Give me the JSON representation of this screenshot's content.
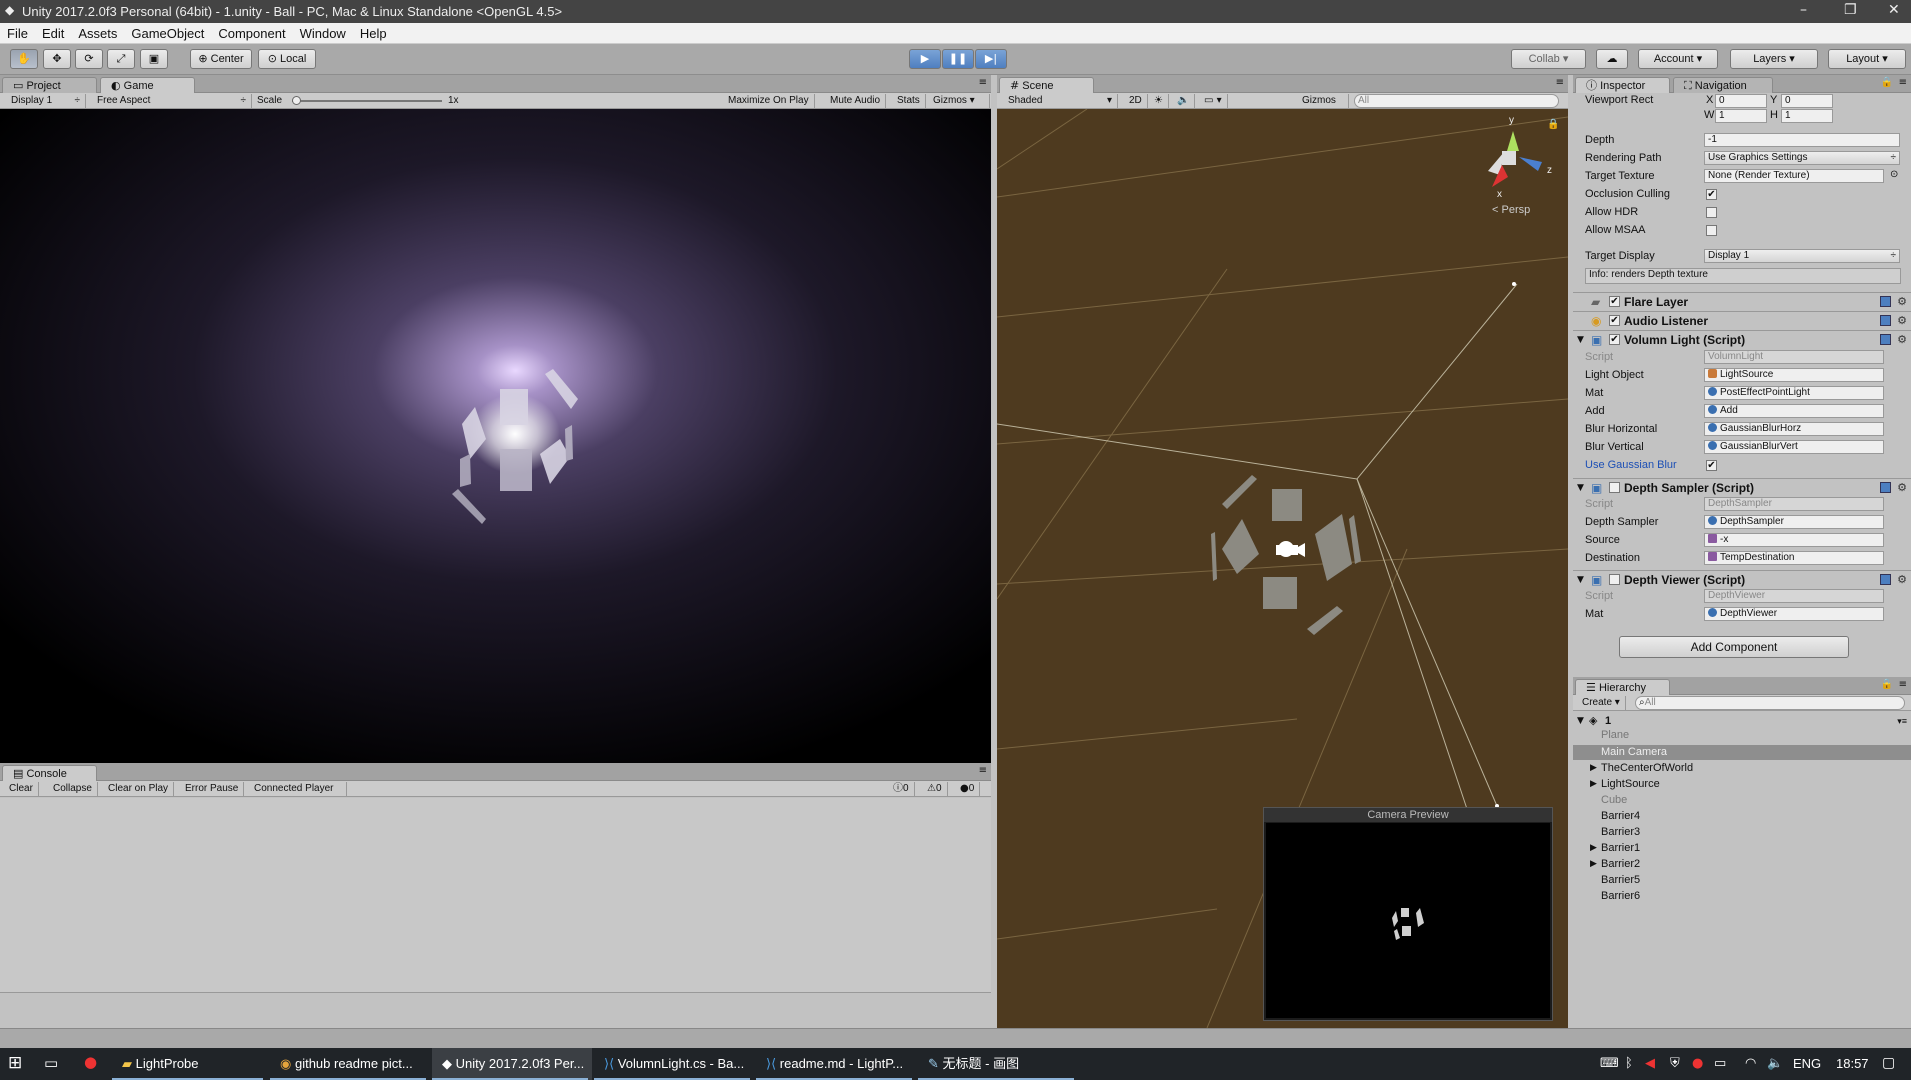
{
  "window": {
    "title": "Unity 2017.2.0f3 Personal (64bit) - 1.unity - Ball - PC, Mac & Linux Standalone <OpenGL 4.5>"
  },
  "menu": [
    "File",
    "Edit",
    "Assets",
    "GameObject",
    "Component",
    "Window",
    "Help"
  ],
  "toolbar": {
    "pivot": "Center",
    "space": "Local",
    "collab": "Collab",
    "account": "Account",
    "layers": "Layers",
    "layout": "Layout"
  },
  "left_tabs": {
    "project": "Project",
    "game": "Game"
  },
  "game_bar": {
    "display": "Display 1",
    "aspect": "Free Aspect",
    "scale_label": "Scale",
    "scale_value": "1x",
    "maximize": "Maximize On Play",
    "mute": "Mute Audio",
    "stats": "Stats",
    "gizmos": "Gizmos"
  },
  "scene_tab": "Scene",
  "scene_bar": {
    "shading": "Shaded",
    "mode2d": "2D",
    "gizmos": "Gizmos",
    "search_placeholder": "All"
  },
  "scene_gizmo": {
    "label": "Persp",
    "y": "y",
    "z": "z",
    "x": "x"
  },
  "camera_preview": {
    "title": "Camera Preview"
  },
  "inspector": {
    "tab": "Inspector",
    "nav_tab": "Navigation",
    "viewport_rect": {
      "label": "Viewport Rect",
      "x_label": "X",
      "x": "0",
      "y_label": "Y",
      "y": "0",
      "w_label": "W",
      "w": "1",
      "h_label": "H",
      "h": "1"
    },
    "depth": {
      "label": "Depth",
      "value": "-1"
    },
    "rendering_path": {
      "label": "Rendering Path",
      "value": "Use Graphics Settings"
    },
    "target_texture": {
      "label": "Target Texture",
      "value": "None (Render Texture)"
    },
    "occlusion": {
      "label": "Occlusion Culling",
      "checked": "✔"
    },
    "allow_hdr": {
      "label": "Allow HDR"
    },
    "allow_msaa": {
      "label": "Allow MSAA"
    },
    "target_display": {
      "label": "Target Display",
      "value": "Display 1"
    },
    "info": "Info: renders Depth texture",
    "flare_layer": "Flare Layer",
    "audio_listener": "Audio Listener",
    "volumn_light": {
      "title": "Volumn Light (Script)",
      "script": {
        "label": "Script",
        "value": "VolumnLight"
      },
      "light_object": {
        "label": "Light Object",
        "value": "LightSource"
      },
      "mat": {
        "label": "Mat",
        "value": "PostEffectPointLight"
      },
      "add": {
        "label": "Add",
        "value": "Add"
      },
      "blur_h": {
        "label": "Blur Horizontal",
        "value": "GaussianBlurHorz"
      },
      "blur_v": {
        "label": "Blur Vertical",
        "value": "GaussianBlurVert"
      },
      "use_gauss": {
        "label": "Use Gaussian Blur",
        "checked": "✔"
      }
    },
    "depth_sampler": {
      "title": "Depth Sampler (Script)",
      "script": {
        "label": "Script",
        "value": "DepthSampler"
      },
      "sampler": {
        "label": "Depth Sampler",
        "value": "DepthSampler"
      },
      "source": {
        "label": "Source",
        "value": "-x"
      },
      "destination": {
        "label": "Destination",
        "value": "TempDestination"
      }
    },
    "depth_viewer": {
      "title": "Depth Viewer (Script)",
      "script": {
        "label": "Script",
        "value": "DepthViewer"
      },
      "mat": {
        "label": "Mat",
        "value": "DepthViewer"
      }
    },
    "add_component": "Add Component"
  },
  "hierarchy": {
    "tab": "Hierarchy",
    "create": "Create",
    "search_placeholder": "All",
    "scene": "1",
    "items": [
      "Plane",
      "Main Camera",
      "TheCenterOfWorld",
      "LightSource",
      "Cube",
      "Barrier4",
      "Barrier3",
      "Barrier1",
      "Barrier2",
      "Barrier5",
      "Barrier6"
    ]
  },
  "console": {
    "tab": "Console",
    "clear": "Clear",
    "collapse": "Collapse",
    "clear_on_play": "Clear on Play",
    "error_pause": "Error Pause",
    "connected": "Connected Player",
    "info_count": "0",
    "warn_count": "0",
    "error_count": "0"
  },
  "taskbar": {
    "apps": [
      "LightProbe",
      "github readme pict...",
      "Unity 2017.2.0f3 Per...",
      "VolumnLight.cs - Ba...",
      "readme.md - LightP...",
      "无标题 - 画图"
    ],
    "lang": "ENG",
    "time": "18:57"
  }
}
